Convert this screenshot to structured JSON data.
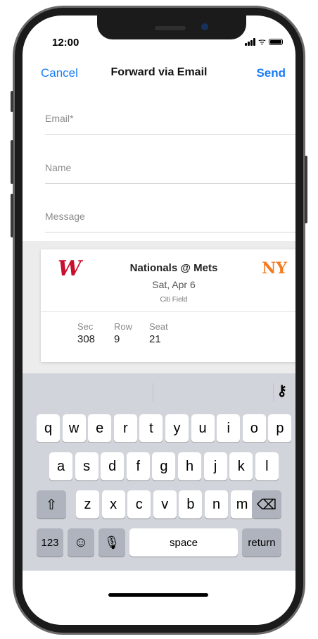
{
  "status_bar": {
    "time": "12:00"
  },
  "nav": {
    "cancel": "Cancel",
    "title": "Forward via Email",
    "send": "Send"
  },
  "form": {
    "email_placeholder": "Email*",
    "name_placeholder": "Name",
    "message_placeholder": "Message"
  },
  "ticket": {
    "title": "Nationals @ Mets",
    "date": "Sat, Apr 6",
    "venue": "Citi Field",
    "home_logo": "NY",
    "away_logo": "W",
    "sec_label": "Sec",
    "sec_value": "308",
    "row_label": "Row",
    "row_value": "9",
    "seat_label": "Seat",
    "seat_value": "21"
  },
  "keyboard": {
    "row1": [
      "q",
      "w",
      "e",
      "r",
      "t",
      "y",
      "u",
      "i",
      "o",
      "p"
    ],
    "row2": [
      "a",
      "s",
      "d",
      "f",
      "g",
      "h",
      "j",
      "k",
      "l"
    ],
    "row3": [
      "z",
      "x",
      "c",
      "v",
      "b",
      "n",
      "m"
    ],
    "shift": "⇧",
    "delete": "⌫",
    "numbers": "123",
    "emoji": "☺",
    "mic": "🎙",
    "space": "space",
    "return": "return",
    "key_icon": "⚷"
  },
  "colors": {
    "accent": "#1a7cf5",
    "nationals": "#c8102e",
    "mets": "#f47a20"
  }
}
